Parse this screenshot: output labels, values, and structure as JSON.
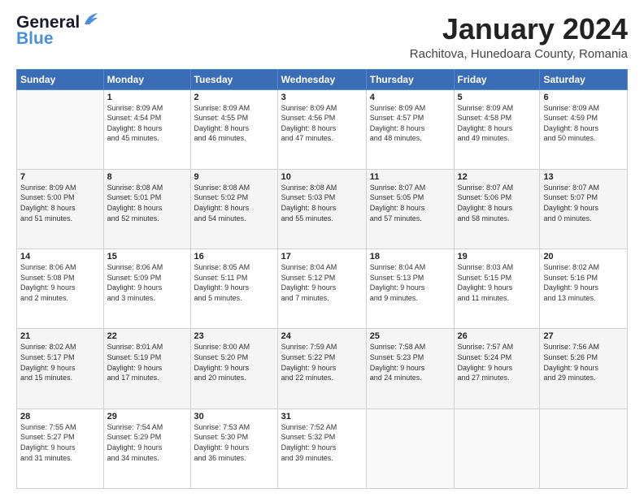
{
  "header": {
    "logo_general": "General",
    "logo_blue": "Blue",
    "month": "January 2024",
    "location": "Rachitova, Hunedoara County, Romania"
  },
  "days_header": [
    "Sunday",
    "Monday",
    "Tuesday",
    "Wednesday",
    "Thursday",
    "Friday",
    "Saturday"
  ],
  "weeks": [
    [
      {
        "num": "",
        "info": ""
      },
      {
        "num": "1",
        "info": "Sunrise: 8:09 AM\nSunset: 4:54 PM\nDaylight: 8 hours\nand 45 minutes."
      },
      {
        "num": "2",
        "info": "Sunrise: 8:09 AM\nSunset: 4:55 PM\nDaylight: 8 hours\nand 46 minutes."
      },
      {
        "num": "3",
        "info": "Sunrise: 8:09 AM\nSunset: 4:56 PM\nDaylight: 8 hours\nand 47 minutes."
      },
      {
        "num": "4",
        "info": "Sunrise: 8:09 AM\nSunset: 4:57 PM\nDaylight: 8 hours\nand 48 minutes."
      },
      {
        "num": "5",
        "info": "Sunrise: 8:09 AM\nSunset: 4:58 PM\nDaylight: 8 hours\nand 49 minutes."
      },
      {
        "num": "6",
        "info": "Sunrise: 8:09 AM\nSunset: 4:59 PM\nDaylight: 8 hours\nand 50 minutes."
      }
    ],
    [
      {
        "num": "7",
        "info": "Sunrise: 8:09 AM\nSunset: 5:00 PM\nDaylight: 8 hours\nand 51 minutes."
      },
      {
        "num": "8",
        "info": "Sunrise: 8:08 AM\nSunset: 5:01 PM\nDaylight: 8 hours\nand 52 minutes."
      },
      {
        "num": "9",
        "info": "Sunrise: 8:08 AM\nSunset: 5:02 PM\nDaylight: 8 hours\nand 54 minutes."
      },
      {
        "num": "10",
        "info": "Sunrise: 8:08 AM\nSunset: 5:03 PM\nDaylight: 8 hours\nand 55 minutes."
      },
      {
        "num": "11",
        "info": "Sunrise: 8:07 AM\nSunset: 5:05 PM\nDaylight: 8 hours\nand 57 minutes."
      },
      {
        "num": "12",
        "info": "Sunrise: 8:07 AM\nSunset: 5:06 PM\nDaylight: 8 hours\nand 58 minutes."
      },
      {
        "num": "13",
        "info": "Sunrise: 8:07 AM\nSunset: 5:07 PM\nDaylight: 9 hours\nand 0 minutes."
      }
    ],
    [
      {
        "num": "14",
        "info": "Sunrise: 8:06 AM\nSunset: 5:08 PM\nDaylight: 9 hours\nand 2 minutes."
      },
      {
        "num": "15",
        "info": "Sunrise: 8:06 AM\nSunset: 5:09 PM\nDaylight: 9 hours\nand 3 minutes."
      },
      {
        "num": "16",
        "info": "Sunrise: 8:05 AM\nSunset: 5:11 PM\nDaylight: 9 hours\nand 5 minutes."
      },
      {
        "num": "17",
        "info": "Sunrise: 8:04 AM\nSunset: 5:12 PM\nDaylight: 9 hours\nand 7 minutes."
      },
      {
        "num": "18",
        "info": "Sunrise: 8:04 AM\nSunset: 5:13 PM\nDaylight: 9 hours\nand 9 minutes."
      },
      {
        "num": "19",
        "info": "Sunrise: 8:03 AM\nSunset: 5:15 PM\nDaylight: 9 hours\nand 11 minutes."
      },
      {
        "num": "20",
        "info": "Sunrise: 8:02 AM\nSunset: 5:16 PM\nDaylight: 9 hours\nand 13 minutes."
      }
    ],
    [
      {
        "num": "21",
        "info": "Sunrise: 8:02 AM\nSunset: 5:17 PM\nDaylight: 9 hours\nand 15 minutes."
      },
      {
        "num": "22",
        "info": "Sunrise: 8:01 AM\nSunset: 5:19 PM\nDaylight: 9 hours\nand 17 minutes."
      },
      {
        "num": "23",
        "info": "Sunrise: 8:00 AM\nSunset: 5:20 PM\nDaylight: 9 hours\nand 20 minutes."
      },
      {
        "num": "24",
        "info": "Sunrise: 7:59 AM\nSunset: 5:22 PM\nDaylight: 9 hours\nand 22 minutes."
      },
      {
        "num": "25",
        "info": "Sunrise: 7:58 AM\nSunset: 5:23 PM\nDaylight: 9 hours\nand 24 minutes."
      },
      {
        "num": "26",
        "info": "Sunrise: 7:57 AM\nSunset: 5:24 PM\nDaylight: 9 hours\nand 27 minutes."
      },
      {
        "num": "27",
        "info": "Sunrise: 7:56 AM\nSunset: 5:26 PM\nDaylight: 9 hours\nand 29 minutes."
      }
    ],
    [
      {
        "num": "28",
        "info": "Sunrise: 7:55 AM\nSunset: 5:27 PM\nDaylight: 9 hours\nand 31 minutes."
      },
      {
        "num": "29",
        "info": "Sunrise: 7:54 AM\nSunset: 5:29 PM\nDaylight: 9 hours\nand 34 minutes."
      },
      {
        "num": "30",
        "info": "Sunrise: 7:53 AM\nSunset: 5:30 PM\nDaylight: 9 hours\nand 36 minutes."
      },
      {
        "num": "31",
        "info": "Sunrise: 7:52 AM\nSunset: 5:32 PM\nDaylight: 9 hours\nand 39 minutes."
      },
      {
        "num": "",
        "info": ""
      },
      {
        "num": "",
        "info": ""
      },
      {
        "num": "",
        "info": ""
      }
    ]
  ]
}
